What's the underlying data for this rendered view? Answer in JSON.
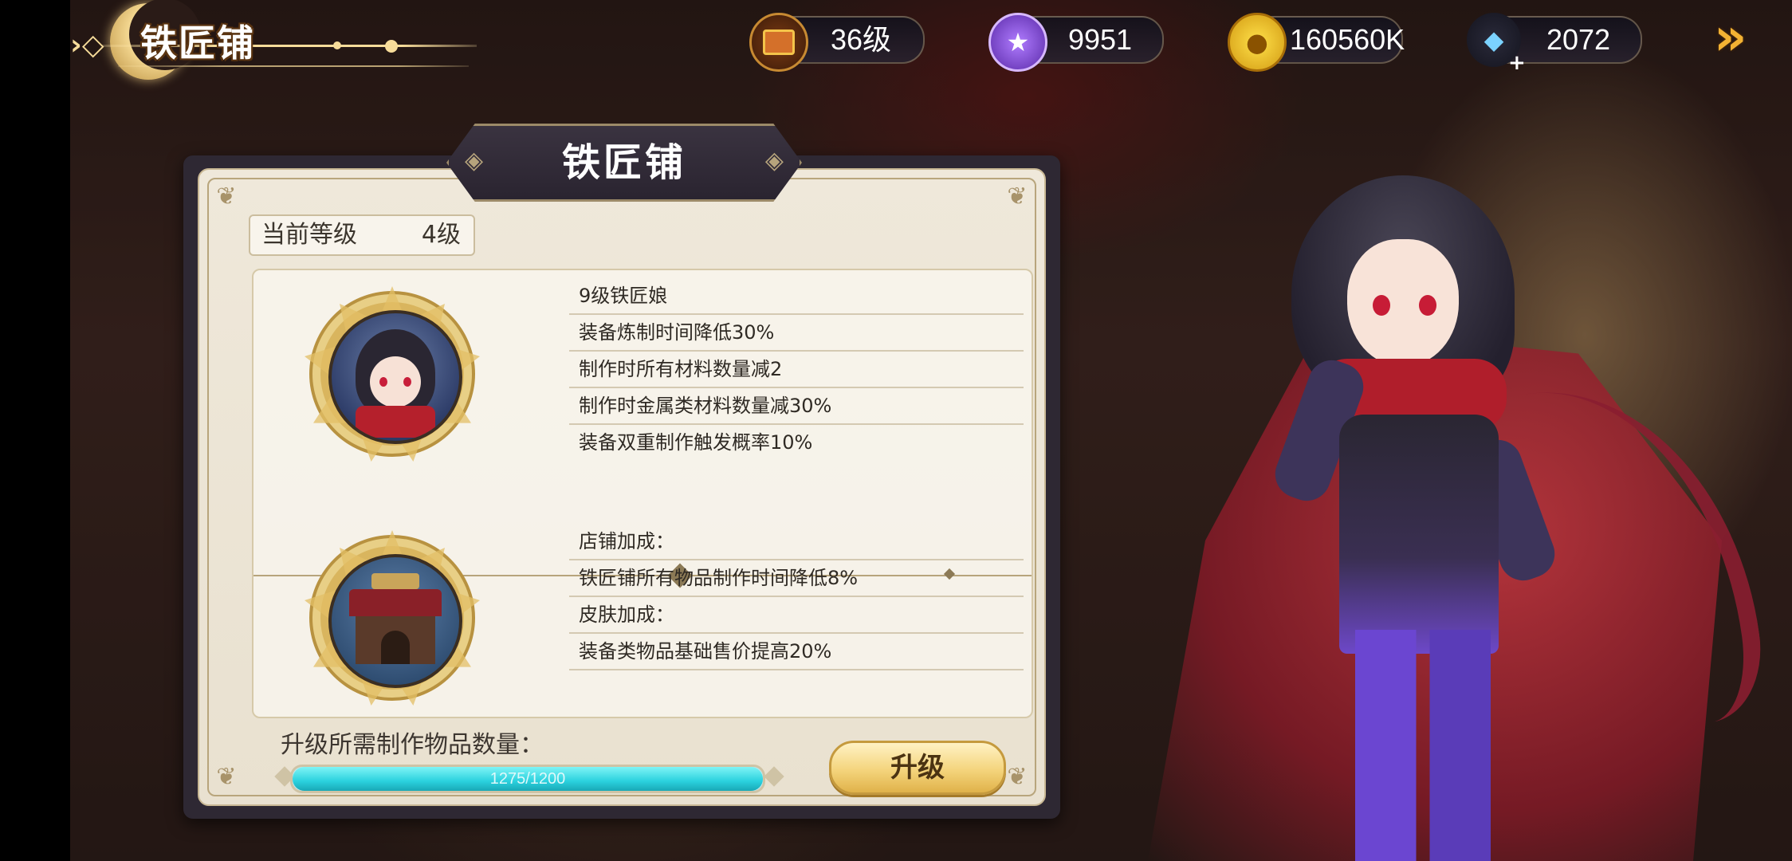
{
  "header": {
    "title": "铁匠铺",
    "resources": [
      {
        "icon": "chest-icon",
        "value": "36级"
      },
      {
        "icon": "purple-star-token-icon",
        "value": "9951"
      },
      {
        "icon": "gold-coin-icon",
        "value": "160560K"
      },
      {
        "icon": "blue-diamond-icon",
        "value": "2072",
        "plus": "+"
      }
    ]
  },
  "panel": {
    "title": "铁匠铺",
    "level_label": "当前等级",
    "level_value": "4级",
    "blacksmith_bonuses": [
      "9级铁匠娘",
      "装备炼制时间降低30%",
      "制作时所有材料数量减2",
      "制作时金属类材料数量减30%",
      "装备双重制作触发概率10%"
    ],
    "shop_bonuses": [
      "店铺加成：",
      "铁匠铺所有物品制作时间降低8%",
      "皮肤加成：",
      "装备类物品基础售价提高20%"
    ],
    "requirement_label": "升级所需制作物品数量：",
    "progress_text": "1275/1200",
    "progress_fraction": 1.0,
    "upgrade_button": "升级"
  },
  "colors": {
    "accent_gold": "#f4d47c",
    "progress_cyan": "#2ad1de",
    "panel_bg": "#efe8da"
  }
}
